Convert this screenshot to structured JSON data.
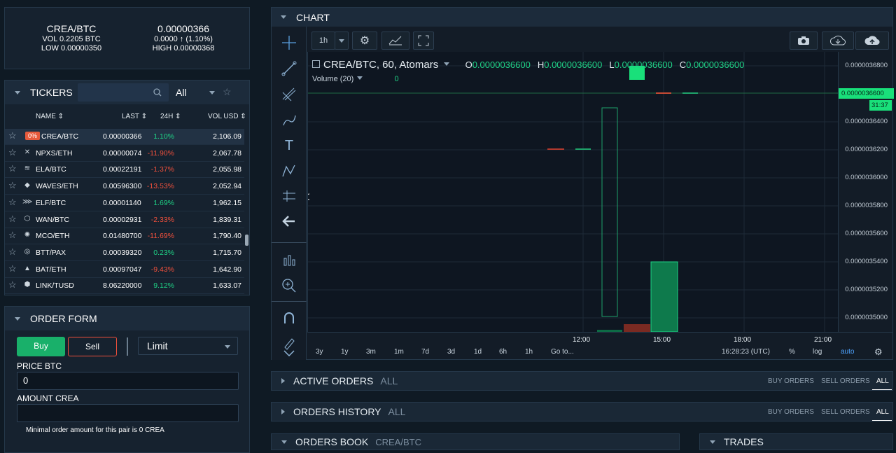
{
  "summary": {
    "pair": "CREA/BTC",
    "vol": "VOL 0.2205 BTC",
    "low": "LOW 0.00000350",
    "price": "0.00000366",
    "change": "0.0000 ↑ (1.10%)",
    "high": "HIGH 0.00000368"
  },
  "tickers": {
    "title": "TICKERS",
    "filter": "All",
    "columns": {
      "name": "NAME",
      "last": "LAST",
      "change": "24H",
      "vol": "VOL USD"
    },
    "rows": [
      {
        "badge": "0%",
        "name": "CREA/BTC",
        "last": "0.00000366",
        "change": "1.10%",
        "vol": "2,106.09",
        "up": true
      },
      {
        "name": "NPXS/ETH",
        "last": "0.00000074",
        "change": "-11.90%",
        "vol": "2,067.78",
        "up": false
      },
      {
        "name": "ELA/BTC",
        "last": "0.00022191",
        "change": "-1.37%",
        "vol": "2,055.98",
        "up": false
      },
      {
        "name": "WAVES/ETH",
        "last": "0.00596300",
        "change": "-13.53%",
        "vol": "2,052.94",
        "up": false
      },
      {
        "name": "ELF/BTC",
        "last": "0.00001140",
        "change": "1.69%",
        "vol": "1,962.15",
        "up": true
      },
      {
        "name": "WAN/BTC",
        "last": "0.00002931",
        "change": "-2.33%",
        "vol": "1,839.31",
        "up": false
      },
      {
        "name": "MCO/ETH",
        "last": "0.01480700",
        "change": "-11.69%",
        "vol": "1,790.40",
        "up": false
      },
      {
        "name": "BTT/PAX",
        "last": "0.00039320",
        "change": "0.23%",
        "vol": "1,715.70",
        "up": true
      },
      {
        "name": "BAT/ETH",
        "last": "0.00097047",
        "change": "-9.43%",
        "vol": "1,642.90",
        "up": false
      },
      {
        "name": "LINK/TUSD",
        "last": "8.06220000",
        "change": "9.12%",
        "vol": "1,633.07",
        "up": true
      }
    ]
  },
  "order_form": {
    "title": "ORDER FORM",
    "buy": "Buy",
    "sell": "Sell",
    "type": "Limit",
    "price_label": "PRICE BTC",
    "price_value": "0",
    "amount_label": "AMOUNT CREA",
    "hint": "Minimal order amount for this pair is 0 CREA"
  },
  "chart": {
    "title": "CHART",
    "interval": "1h",
    "symbol": "CREA/BTC, 60, Atomars",
    "o": "0.0000036600",
    "h": "0.0000036600",
    "l": "0.0000036600",
    "c": "0.0000036600",
    "volume_label": "Volume (20)",
    "volume_value": "0",
    "price_tag": "0.0000036600",
    "countdown": "31:37",
    "y_ticks": [
      "0.0000036800",
      "0.0000036400",
      "0.0000036200",
      "0.0000036000",
      "0.0000035800",
      "0.0000035600",
      "0.0000035400",
      "0.0000035200",
      "0.0000035000"
    ],
    "x_ticks": [
      "12:00",
      "15:00",
      "18:00",
      "21:00"
    ],
    "ranges": [
      "3y",
      "1y",
      "3m",
      "1m",
      "7d",
      "3d",
      "1d",
      "6h",
      "1h",
      "Go to..."
    ],
    "clock": "16:28:23 (UTC)",
    "pct": "%",
    "log": "log",
    "auto": "auto"
  },
  "active_orders": {
    "title": "ACTIVE ORDERS",
    "sub": "ALL",
    "buy": "BUY ORDERS",
    "sell": "SELL ORDERS",
    "all": "ALL"
  },
  "orders_history": {
    "title": "ORDERS HISTORY",
    "sub": "ALL",
    "buy": "BUY ORDERS",
    "sell": "SELL ORDERS",
    "all": "ALL"
  },
  "orders_book": {
    "title": "ORDERS BOOK",
    "sub": "CREA/BTC"
  },
  "trades": {
    "title": "TRADES"
  },
  "colors": {
    "up": "#1fd286",
    "down": "#f0503c",
    "accent": "#19b06a"
  }
}
